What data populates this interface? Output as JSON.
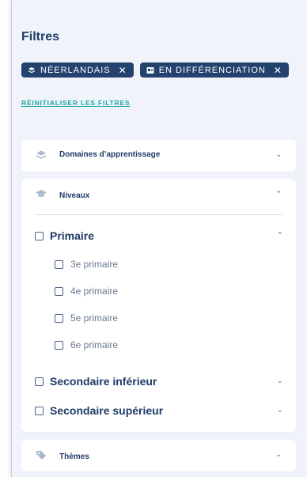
{
  "filters": {
    "title": "Filtres",
    "chips": [
      {
        "label": "NÉERLANDAIS",
        "icon": "layers-icon"
      },
      {
        "label": "EN DIFFÉRENCIATION",
        "icon": "id-card-icon"
      }
    ],
    "reset_label": "RÉINITIALISER LES FILTRES"
  },
  "sections": {
    "domaines": {
      "label": "Domaines d’apprentissage",
      "icon": "layers-icon",
      "expanded": false
    },
    "niveaux": {
      "label": "Niveaux",
      "icon": "graduation-cap-icon",
      "expanded": true,
      "levels": [
        {
          "label": "Primaire",
          "expanded": true,
          "sublevels": [
            "3e primaire",
            "4e primaire",
            "5e primaire",
            "6e primaire"
          ]
        },
        {
          "label": "Secondaire inférieur",
          "expanded": false
        },
        {
          "label": "Secondaire supérieur",
          "expanded": false
        }
      ]
    },
    "themes": {
      "label": "Thèmes",
      "icon": "tag-icon",
      "expanded": false
    }
  },
  "colors": {
    "navy": "#1e3a66",
    "chip_bg": "#24426e",
    "link_teal": "#1aa7a0",
    "panel_bg": "#f0f4fa"
  }
}
